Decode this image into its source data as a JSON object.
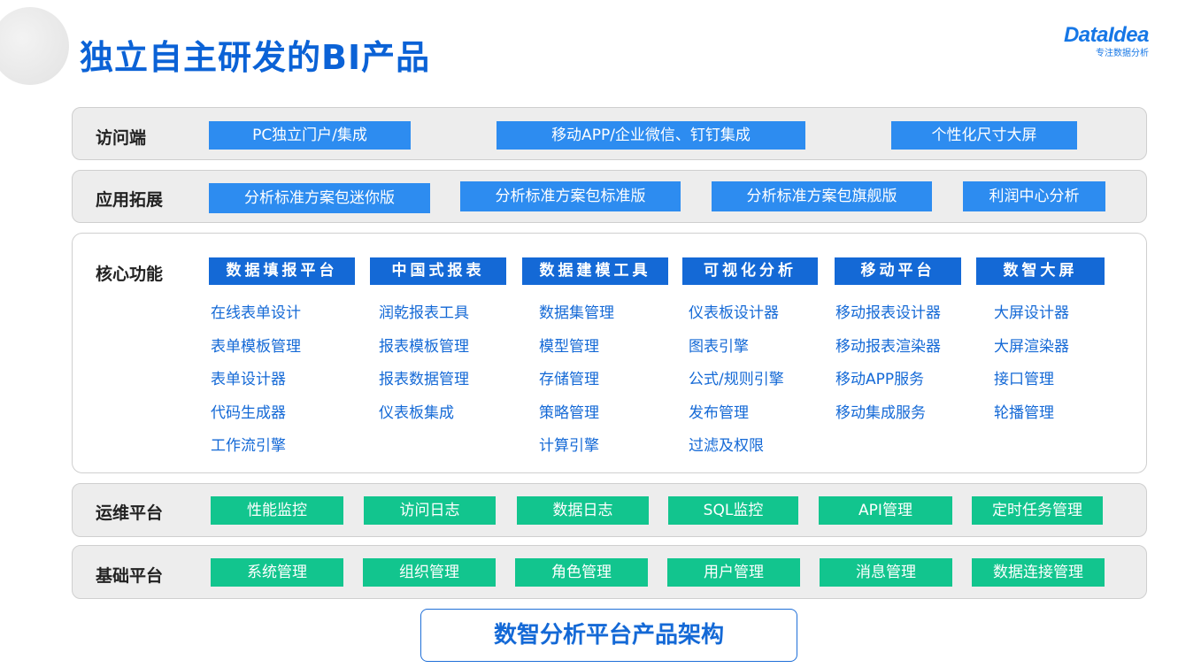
{
  "title": "独立自主研发的BI产品",
  "logo": {
    "brand": "DataIdea",
    "tagline": "专注数据分析"
  },
  "rows": {
    "access": {
      "label": "访问端",
      "items": [
        "PC独立门户/集成",
        "移动APP/企业微信、钉钉集成",
        "个性化尺寸大屏"
      ]
    },
    "extension": {
      "label": "应用拓展",
      "items": [
        "分析标准方案包迷你版",
        "分析标准方案包标准版",
        "分析标准方案包旗舰版",
        "利润中心分析"
      ]
    },
    "core": {
      "label": "核心功能",
      "columns": [
        {
          "title": "数据填报平台",
          "items": [
            "在线表单设计",
            "表单模板管理",
            "表单设计器",
            "代码生成器",
            "工作流引擎"
          ]
        },
        {
          "title": "中国式报表",
          "items": [
            "润乾报表工具",
            "报表模板管理",
            "报表数据管理",
            "仪表板集成"
          ]
        },
        {
          "title": "数据建模工具",
          "items": [
            "数据集管理",
            "模型管理",
            "存储管理",
            "策略管理",
            "计算引擎"
          ]
        },
        {
          "title": "可视化分析",
          "items": [
            "仪表板设计器",
            "图表引擎",
            "公式/规则引擎",
            "发布管理",
            "过滤及权限"
          ]
        },
        {
          "title": "移动平台",
          "items": [
            "移动报表设计器",
            "移动报表渲染器",
            "移动APP服务",
            "移动集成服务"
          ]
        },
        {
          "title": "数智大屏",
          "items": [
            "大屏设计器",
            "大屏渲染器",
            "接口管理",
            "轮播管理"
          ]
        }
      ]
    },
    "ops": {
      "label": "运维平台",
      "items": [
        "性能监控",
        "访问日志",
        "数据日志",
        "SQL监控",
        "API管理",
        "定时任务管理"
      ]
    },
    "base": {
      "label": "基础平台",
      "items": [
        "系统管理",
        "组织管理",
        "角色管理",
        "用户管理",
        "消息管理",
        "数据连接管理"
      ]
    }
  },
  "footer": "数智分析平台产品架构",
  "colors": {
    "title": "#0b62d6",
    "pill_blue": "#2d8cf0",
    "header_blue": "#1469d6",
    "pill_green": "#12c58e"
  }
}
